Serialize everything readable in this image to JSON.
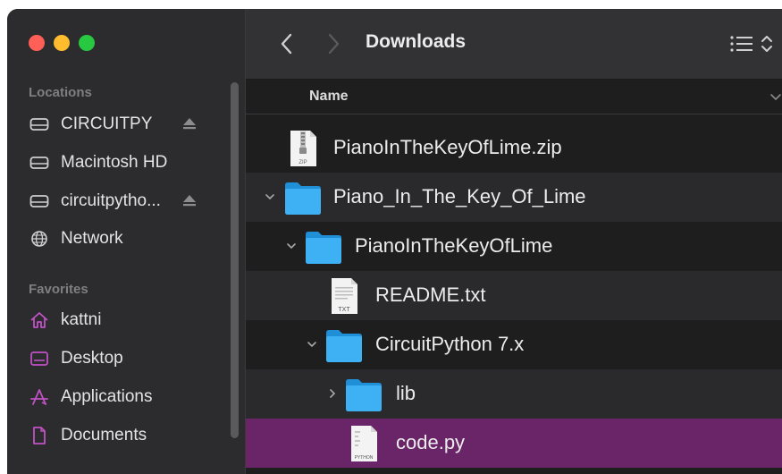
{
  "window": {
    "title": "Downloads"
  },
  "sidebar": {
    "locations_heading": "Locations",
    "locations": [
      {
        "label": "CIRCUITPY",
        "icon": "drive-icon",
        "ejectable": true
      },
      {
        "label": "Macintosh HD",
        "icon": "drive-icon",
        "ejectable": false
      },
      {
        "label": "circuitpytho...",
        "icon": "drive-icon",
        "ejectable": true
      },
      {
        "label": "Network",
        "icon": "globe-icon",
        "ejectable": false
      }
    ],
    "favorites_heading": "Favorites",
    "favorites": [
      {
        "label": "kattni",
        "icon": "home-icon"
      },
      {
        "label": "Desktop",
        "icon": "desktop-icon"
      },
      {
        "label": "Applications",
        "icon": "applications-icon"
      },
      {
        "label": "Documents",
        "icon": "document-icon"
      }
    ]
  },
  "list": {
    "column_name": "Name",
    "rows": [
      {
        "label": "PianoInTheKeyOfLime.zip",
        "type": "zip-file-icon",
        "badge": "ZIP",
        "indent": 0,
        "disclosure": "none"
      },
      {
        "label": "Piano_In_The_Key_Of_Lime",
        "type": "folder-icon",
        "indent": 0,
        "disclosure": "expanded"
      },
      {
        "label": "PianoInTheKeyOfLime",
        "type": "folder-icon",
        "indent": 1,
        "disclosure": "expanded"
      },
      {
        "label": "README.txt",
        "type": "text-file-icon",
        "badge": "TXT",
        "indent": 2,
        "disclosure": "none"
      },
      {
        "label": "CircuitPython 7.x",
        "type": "folder-icon",
        "indent": 2,
        "disclosure": "expanded"
      },
      {
        "label": "lib",
        "type": "folder-icon",
        "indent": 3,
        "disclosure": "collapsed"
      },
      {
        "label": "code.py",
        "type": "python-file-icon",
        "badge": "PYTHON",
        "indent": 3,
        "disclosure": "none",
        "selected": true
      }
    ]
  },
  "colors": {
    "selection": "#6a2468",
    "folder_blue": "#2aa3ee",
    "sidebar_bg": "#2c2b2d"
  }
}
